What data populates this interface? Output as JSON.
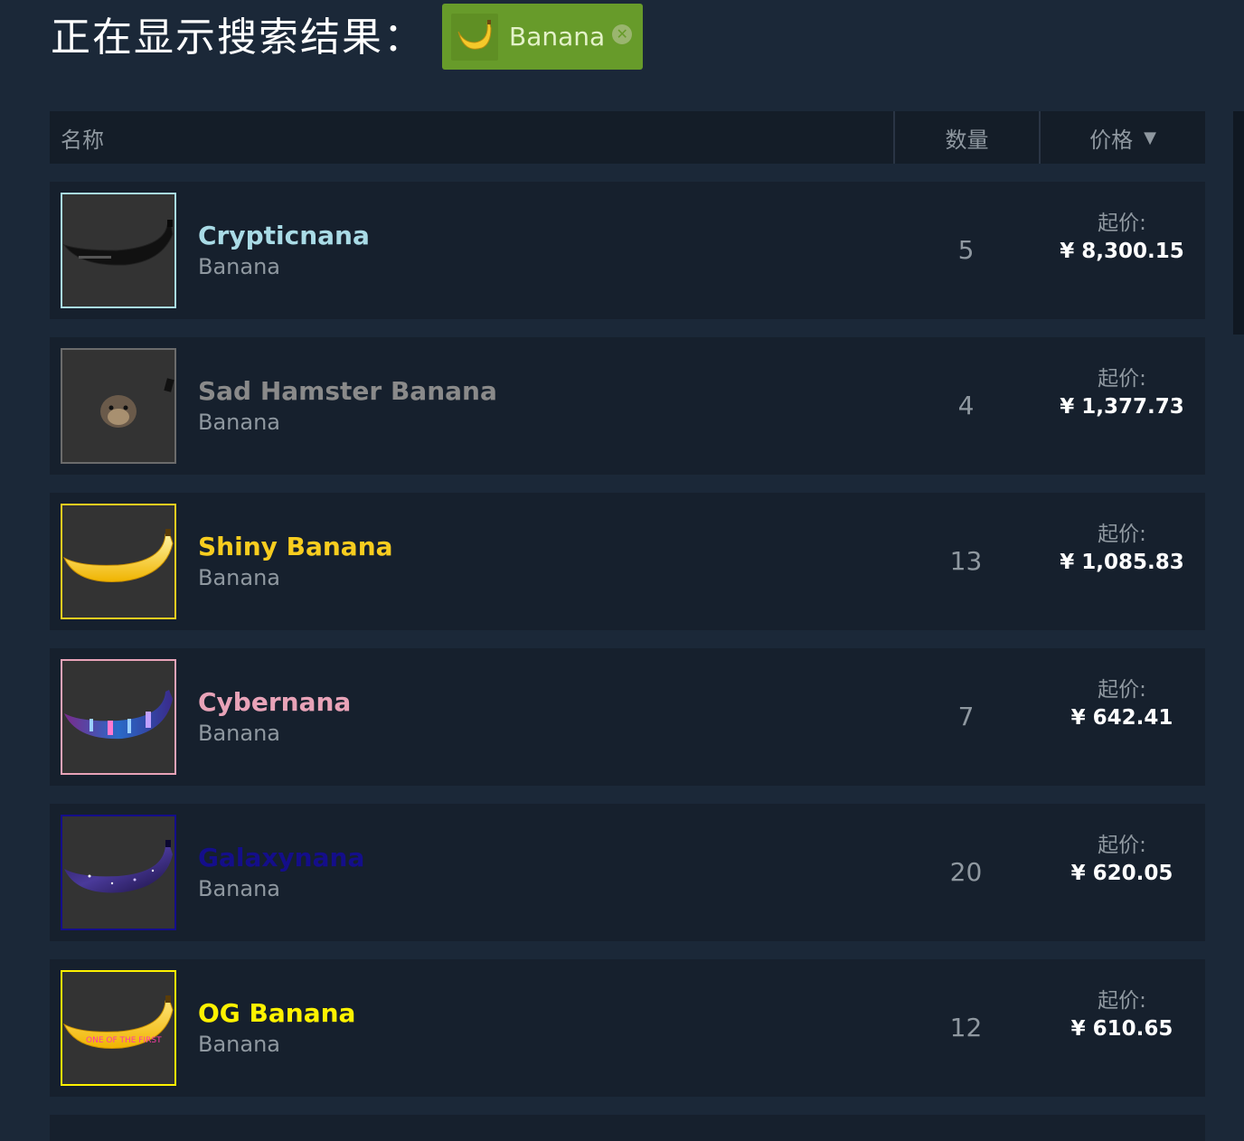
{
  "header": {
    "title": "正在显示搜索结果："
  },
  "filter_chip": {
    "label": "Banana",
    "thumb_icon": "banana-icon",
    "close_icon": "close-icon",
    "color": "#679b2a"
  },
  "table": {
    "columns": {
      "name": "名称",
      "quantity": "数量",
      "price": "价格",
      "sort_indicator": "▼"
    },
    "rows": [
      {
        "name": "Crypticnana",
        "game": "Banana",
        "quantity": "5",
        "price_label": "起价:",
        "price": "¥ 8,300.15",
        "name_color": "#a9dbe6",
        "border_color": "#a9dbe6",
        "icon": "black-banana-icon"
      },
      {
        "name": "Sad Hamster Banana",
        "game": "Banana",
        "quantity": "4",
        "price_label": "起价:",
        "price": "¥ 1,377.73",
        "name_color": "#8a8a8a",
        "border_color": "#6b6b6b",
        "icon": "hamster-icon"
      },
      {
        "name": "Shiny Banana",
        "game": "Banana",
        "quantity": "13",
        "price_label": "起价:",
        "price": "¥ 1,085.83",
        "name_color": "#f8cd1f",
        "border_color": "#f8cd1f",
        "icon": "yellow-banana-icon"
      },
      {
        "name": "Cybernana",
        "game": "Banana",
        "quantity": "7",
        "price_label": "起价:",
        "price": "¥ 642.41",
        "name_color": "#e8a3b8",
        "border_color": "#e8a3b8",
        "icon": "cyber-banana-icon"
      },
      {
        "name": "Galaxynana",
        "game": "Banana",
        "quantity": "20",
        "price_label": "起价:",
        "price": "¥ 620.05",
        "name_color": "#140e8a",
        "border_color": "#140e8a",
        "icon": "galaxy-banana-icon"
      },
      {
        "name": "OG Banana",
        "game": "Banana",
        "quantity": "12",
        "price_label": "起价:",
        "price": "¥ 610.65",
        "name_color": "#fff200",
        "border_color": "#fff200",
        "icon": "og-banana-icon",
        "badge_text": "ONE OF THE FIRST"
      }
    ]
  }
}
